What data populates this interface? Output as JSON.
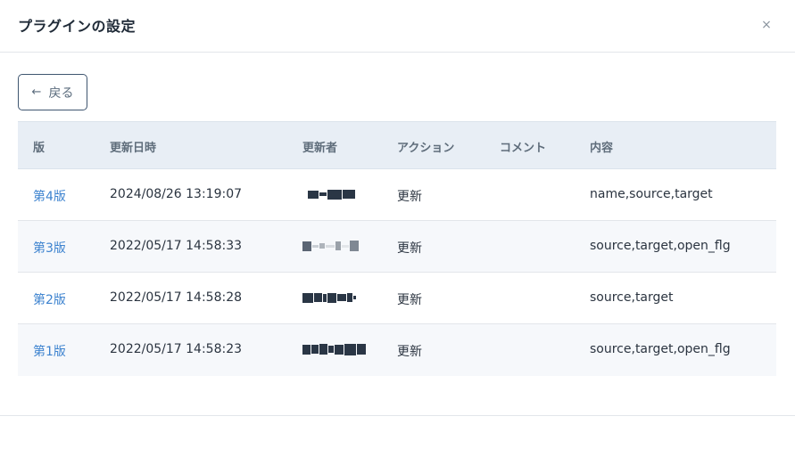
{
  "dialog": {
    "title": "プラグインの設定",
    "close_glyph": "×"
  },
  "back_button": {
    "icon": "arrow-left-icon",
    "label": "戻る"
  },
  "table": {
    "headers": {
      "version": "版",
      "updated_at": "更新日時",
      "updated_by": "更新者",
      "action": "アクション",
      "comment": "コメント",
      "content": "内容"
    },
    "rows": [
      {
        "version": "第4版",
        "updated_at": "2024/08/26 13:19:07",
        "updated_by": "",
        "action": "更新",
        "comment": "",
        "content": "name,source,target"
      },
      {
        "version": "第3版",
        "updated_at": "2022/05/17 14:58:33",
        "updated_by": "",
        "action": "更新",
        "comment": "",
        "content": "source,target,open_flg"
      },
      {
        "version": "第2版",
        "updated_at": "2022/05/17 14:58:28",
        "updated_by": "",
        "action": "更新",
        "comment": "",
        "content": "source,target"
      },
      {
        "version": "第1版",
        "updated_at": "2022/05/17 14:58:23",
        "updated_by": "",
        "action": "更新",
        "comment": "",
        "content": "source,target,open_flg"
      }
    ]
  },
  "colors": {
    "link": "#3d83cf",
    "header_bg": "#e8eef5",
    "row_shade": "#f6f8fb",
    "button_border": "#3f5670"
  }
}
